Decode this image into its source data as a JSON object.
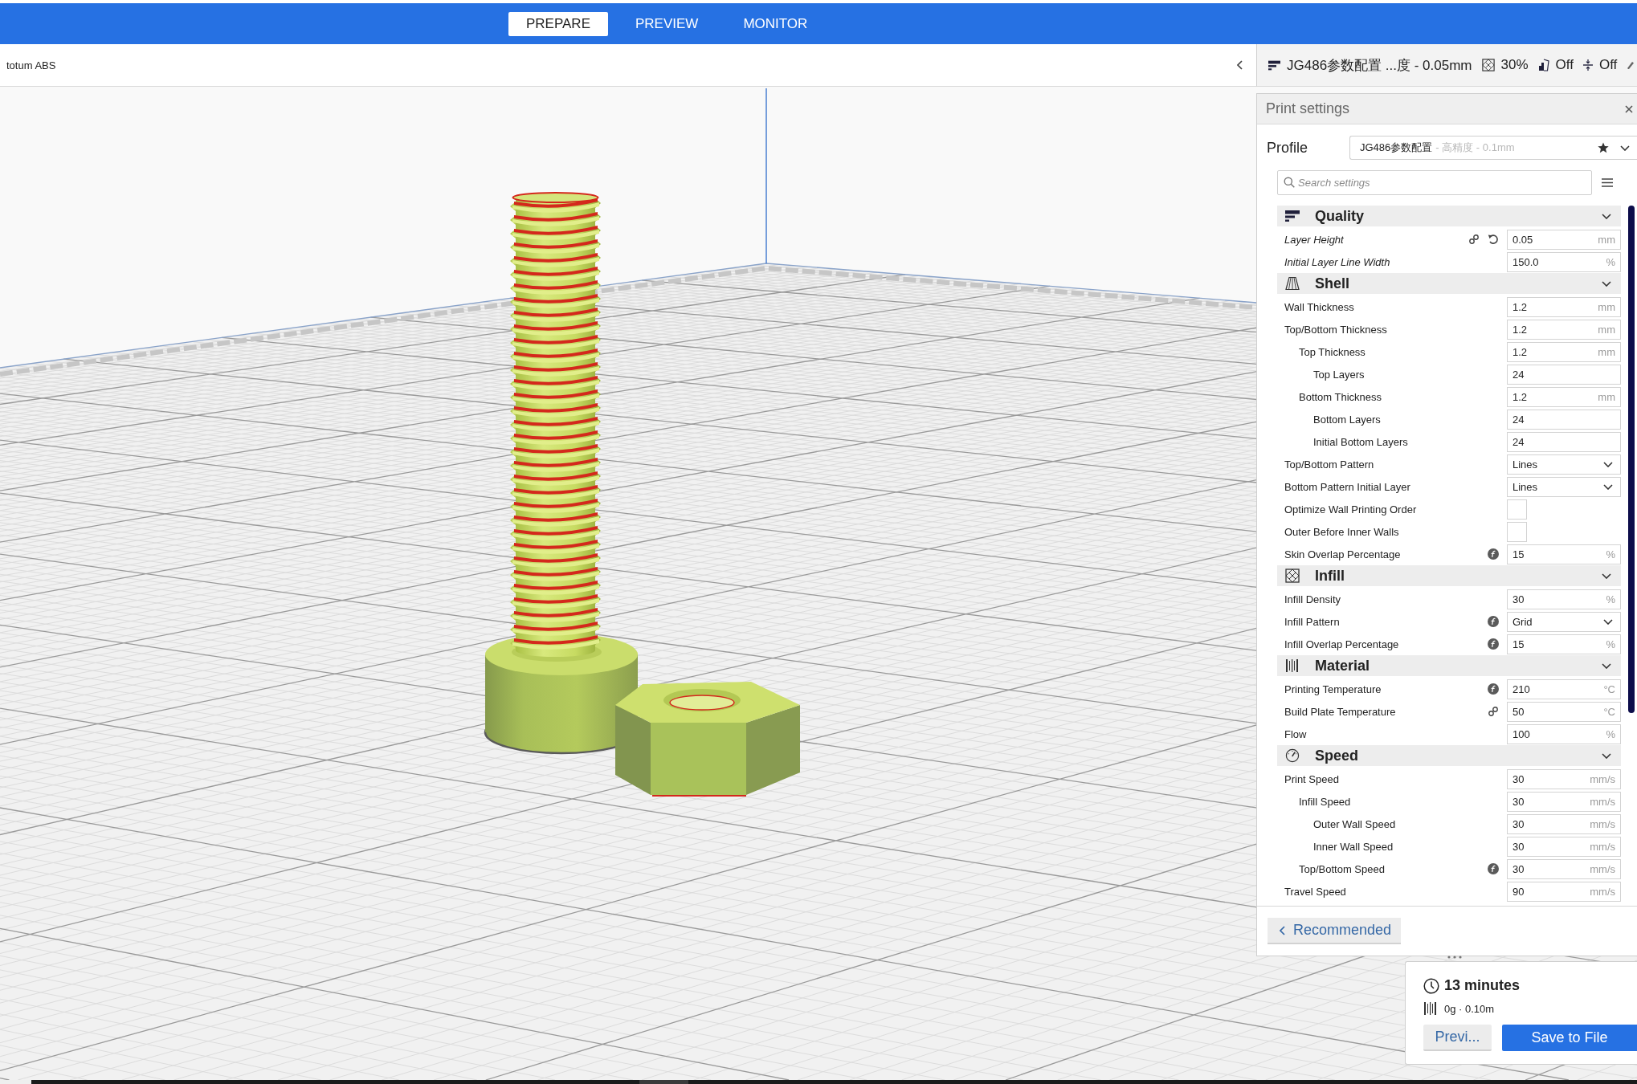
{
  "stage_tabs": [
    {
      "label": "PREPARE",
      "selected": true
    },
    {
      "label": "PREVIEW",
      "selected": false
    },
    {
      "label": "MONITOR",
      "selected": false
    }
  ],
  "header": {
    "material": "totum ABS",
    "print_setup": {
      "profile": "JG486参数配置 ...度 - 0.05mm",
      "infill": "30%",
      "support": "Off",
      "adhesion": "Off"
    }
  },
  "print_settings": {
    "title": "Print settings",
    "profile": {
      "label": "Profile",
      "name": "JG486参数配置",
      "detail": "- 高精度 - 0.1mm"
    },
    "search": {
      "placeholder": "Search settings"
    },
    "categories": [
      {
        "title": "Quality",
        "expanded": true,
        "settings": [
          {
            "label": "Layer Height",
            "kind": "number",
            "value": "0.05",
            "unit": "mm",
            "overridden": true,
            "linked": true,
            "resettable": true,
            "inherited": false
          },
          {
            "label": "Initial Layer Line Width",
            "kind": "number",
            "value": "150.0",
            "unit": "%",
            "overridden": true,
            "linked": false,
            "resettable": false,
            "inherited": false
          }
        ]
      },
      {
        "title": "Shell",
        "expanded": true,
        "settings": [
          {
            "label": "Wall Thickness",
            "kind": "number",
            "value": "1.2",
            "unit": "mm",
            "overridden": false,
            "linked": false,
            "resettable": false,
            "inherited": false
          },
          {
            "label": "Top/Bottom Thickness",
            "kind": "number",
            "value": "1.2",
            "unit": "mm",
            "overridden": false,
            "linked": false,
            "resettable": false,
            "inherited": false,
            "children": [
              {
                "label": "Top Thickness",
                "kind": "number",
                "value": "1.2",
                "unit": "mm",
                "overridden": false,
                "linked": false,
                "resettable": false,
                "inherited": false,
                "children": [
                  {
                    "label": "Top Layers",
                    "kind": "number",
                    "value": "24",
                    "overridden": false,
                    "linked": false,
                    "resettable": false,
                    "inherited": false
                  }
                ]
              },
              {
                "label": "Bottom Thickness",
                "kind": "number",
                "value": "1.2",
                "unit": "mm",
                "overridden": false,
                "linked": false,
                "resettable": false,
                "inherited": false,
                "children": [
                  {
                    "label": "Bottom Layers",
                    "kind": "number",
                    "value": "24",
                    "overridden": false,
                    "linked": false,
                    "resettable": false,
                    "inherited": false
                  },
                  {
                    "label": "Initial Bottom Layers",
                    "kind": "number",
                    "value": "24",
                    "overridden": false,
                    "linked": false,
                    "resettable": false,
                    "inherited": false
                  }
                ]
              }
            ]
          },
          {
            "label": "Top/Bottom Pattern",
            "kind": "dropdown",
            "value": "Lines",
            "overridden": false,
            "linked": false,
            "resettable": false,
            "inherited": false
          },
          {
            "label": "Bottom Pattern Initial Layer",
            "kind": "dropdown",
            "value": "Lines",
            "overridden": false,
            "linked": false,
            "resettable": false,
            "inherited": false
          },
          {
            "label": "Optimize Wall Printing Order",
            "kind": "checkbox",
            "checked": false,
            "overridden": false,
            "linked": false,
            "resettable": false,
            "inherited": false
          },
          {
            "label": "Outer Before Inner Walls",
            "kind": "checkbox",
            "checked": false,
            "overridden": false,
            "linked": false,
            "resettable": false,
            "inherited": false
          },
          {
            "label": "Skin Overlap Percentage",
            "kind": "number",
            "value": "15",
            "unit": "%",
            "overridden": false,
            "linked": false,
            "resettable": false,
            "inherited": true
          }
        ]
      },
      {
        "title": "Infill",
        "expanded": true,
        "settings": [
          {
            "label": "Infill Density",
            "kind": "number",
            "value": "30",
            "unit": "%",
            "overridden": false,
            "linked": false,
            "resettable": false,
            "inherited": false
          },
          {
            "label": "Infill Pattern",
            "kind": "dropdown",
            "value": "Grid",
            "overridden": false,
            "linked": false,
            "resettable": false,
            "inherited": true
          },
          {
            "label": "Infill Overlap Percentage",
            "kind": "number",
            "value": "15",
            "unit": "%",
            "overridden": false,
            "linked": false,
            "resettable": false,
            "inherited": true
          }
        ]
      },
      {
        "title": "Material",
        "expanded": true,
        "settings": [
          {
            "label": "Printing Temperature",
            "kind": "number",
            "value": "210",
            "unit": "°C",
            "overridden": false,
            "linked": false,
            "resettable": false,
            "inherited": true
          },
          {
            "label": "Build Plate Temperature",
            "kind": "number",
            "value": "50",
            "unit": "°C",
            "overridden": false,
            "linked": true,
            "resettable": false,
            "inherited": false
          },
          {
            "label": "Flow",
            "kind": "number",
            "value": "100",
            "unit": "%",
            "overridden": false,
            "linked": false,
            "resettable": false,
            "inherited": false
          }
        ]
      },
      {
        "title": "Speed",
        "expanded": true,
        "settings": [
          {
            "label": "Print Speed",
            "kind": "number",
            "value": "30",
            "unit": "mm/s",
            "overridden": false,
            "linked": false,
            "resettable": false,
            "inherited": false,
            "children": [
              {
                "label": "Infill Speed",
                "kind": "number",
                "value": "30",
                "unit": "mm/s",
                "overridden": false,
                "linked": false,
                "resettable": false,
                "inherited": false,
                "children": [
                  {
                    "label": "Outer Wall Speed",
                    "kind": "number",
                    "value": "30",
                    "unit": "mm/s",
                    "overridden": false,
                    "linked": false,
                    "resettable": false,
                    "inherited": false
                  },
                  {
                    "label": "Inner Wall Speed",
                    "kind": "number",
                    "value": "30",
                    "unit": "mm/s",
                    "overridden": false,
                    "linked": false,
                    "resettable": false,
                    "inherited": false
                  }
                ]
              },
              {
                "label": "Top/Bottom Speed",
                "kind": "number",
                "value": "30",
                "unit": "mm/s",
                "overridden": false,
                "linked": false,
                "resettable": false,
                "inherited": true
              }
            ]
          },
          {
            "label": "Travel Speed",
            "kind": "number",
            "value": "90",
            "unit": "mm/s",
            "overridden": false,
            "linked": false,
            "resettable": false,
            "inherited": false
          }
        ]
      }
    ],
    "footer_button": "Recommended"
  },
  "print_summary": {
    "time": "13 minutes",
    "material_usage": "0g · 0.10m",
    "buttons": [
      {
        "label": "Previ...",
        "kind": "secondary"
      },
      {
        "label": "Save to File",
        "kind": "primary"
      }
    ]
  }
}
